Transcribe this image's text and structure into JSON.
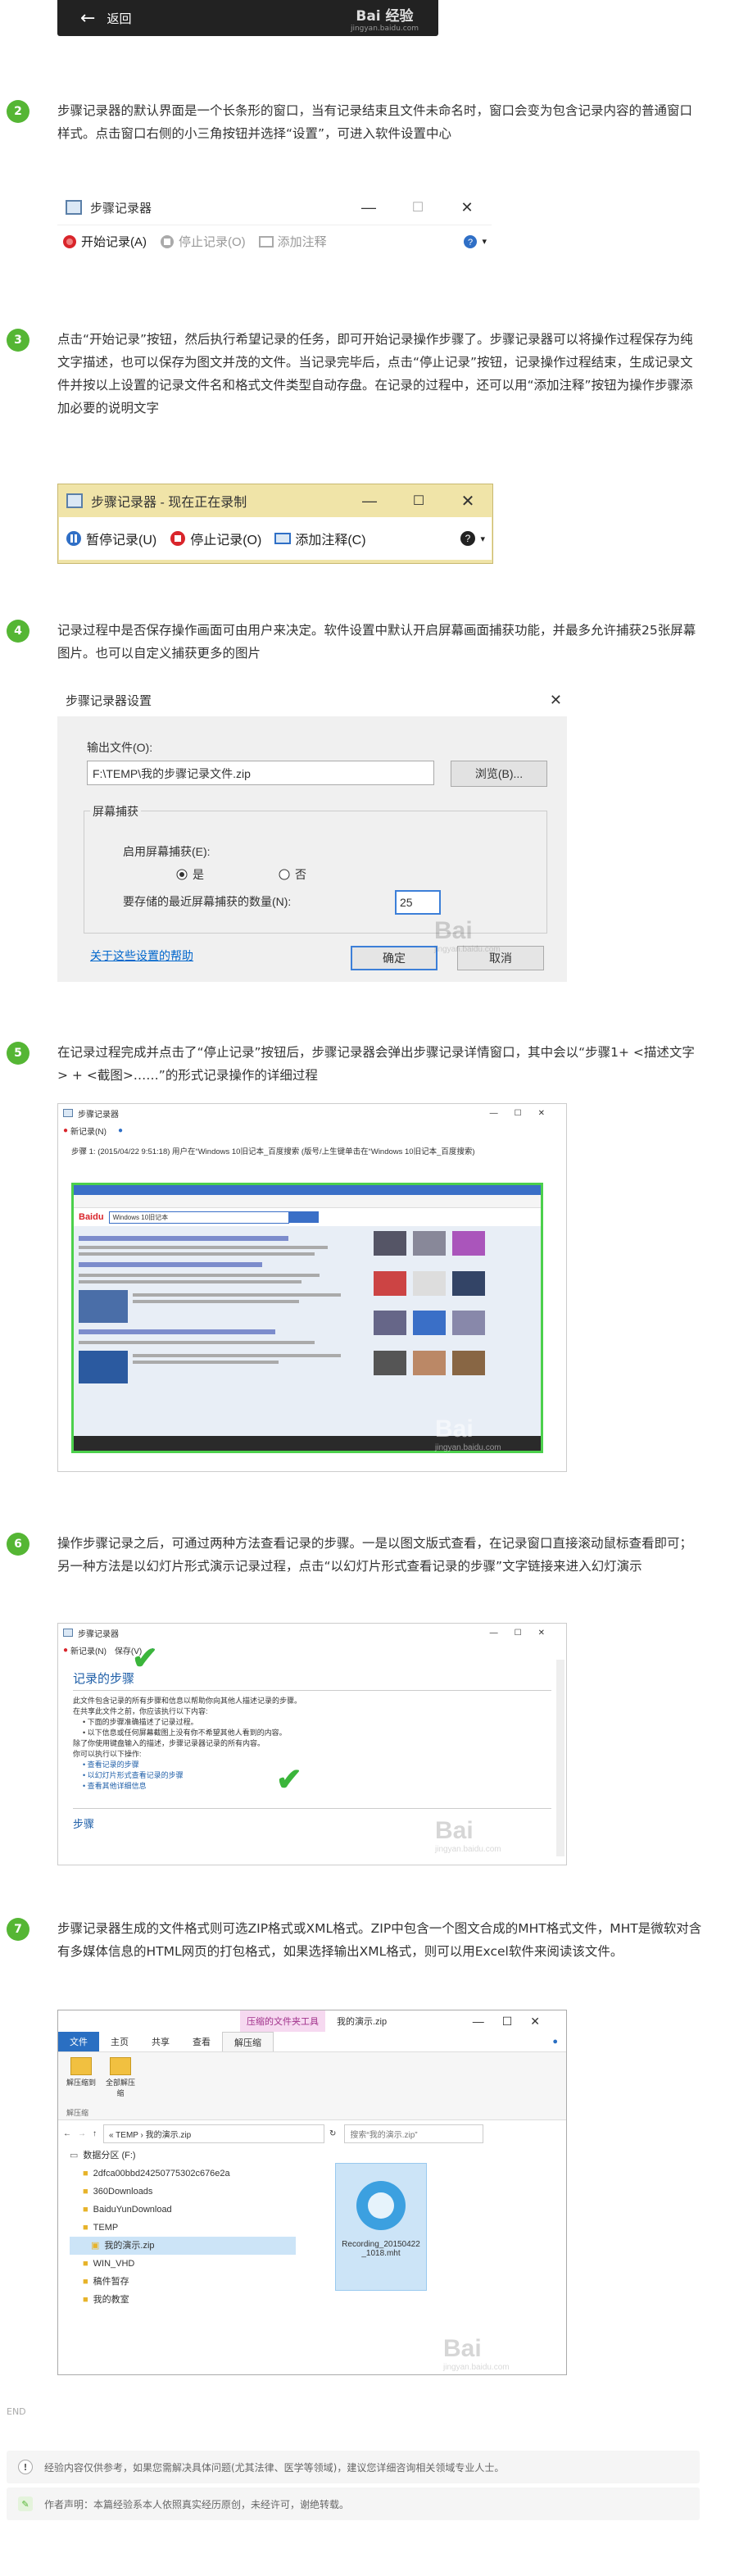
{
  "top_banner": {
    "back_label": "返回",
    "brand": "Bai 经验",
    "site": "jingyan.baidu.com"
  },
  "steps": [
    {
      "num": "2",
      "text": "步骤记录器的默认界面是一个长条形的窗口，当有记录结束且文件未命名时，窗口会变为包含记录内容的普通窗口样式。点击窗口右侧的小三角按钮并选择“设置”，可进入软件设置中心"
    },
    {
      "num": "3",
      "text": "点击“开始记录”按钮，然后执行希望记录的任务，即可开始记录操作步骤了。步骤记录器可以将操作过程保存为纯文字描述，也可以保存为图文并茂的文件。当记录完毕后，点击“停止记录”按钮，记录操作过程结束，生成记录文件并按以上设置的记录文件名和格式文件类型自动存盘。在记录的过程中，还可以用“添加注释”按钮为操作步骤添加必要的说明文字"
    },
    {
      "num": "4",
      "text": "记录过程中是否保存操作画面可由用户来决定。软件设置中默认开启屏幕画面捕获功能，并最多允许捕获25张屏幕图片。也可以自定义捕获更多的图片"
    },
    {
      "num": "5",
      "text": "在记录过程完成并点击了“停止记录”按钮后，步骤记录器会弹出步骤记录详情窗口，其中会以“步骤1+ <描述文字> + <截图>……”的形式记录操作的详细过程"
    },
    {
      "num": "6",
      "text": "操作步骤记录之后，可通过两种方法查看记录的步骤。一是以图文版式查看，在记录窗口直接滚动鼠标查看即可；另一种方法是以幻灯片形式演示记录过程，点击“以幻灯片形式查看记录的步骤”文字链接来进入幻灯演示"
    },
    {
      "num": "7",
      "text": "步骤记录器生成的文件格式则可选ZIP格式或XML格式。ZIP中包含一个图文合成的MHT格式文件，MHT是微软对含有多媒体信息的HTML网页的打包格式，如果选择输出XML格式，则可以用Excel软件来阅读该文件。"
    }
  ],
  "shot1": {
    "title": "步骤记录器",
    "start": "开始记录(A)",
    "stop": "停止记录(O)",
    "note": "添加注释"
  },
  "shot2": {
    "title": "步骤记录器 - 现在正在录制",
    "pause": "暂停记录(U)",
    "stop": "停止记录(O)",
    "note": "添加注释(C)"
  },
  "shot3": {
    "title": "步骤记录器设置",
    "output_label": "输出文件(O):",
    "output_value": "F:\\TEMP\\我的步骤记录文件.zip",
    "browse": "浏览(B)...",
    "group": "屏幕捕获",
    "enable_label": "启用屏幕捕获(E):",
    "yes": "是",
    "no": "否",
    "count_label": "要存储的最近屏幕捕获的数量(N):",
    "count_value": "25",
    "help_link": "关于这些设置的帮助",
    "ok": "确定",
    "cancel": "取消"
  },
  "shot4": {
    "title": "步骤记录器",
    "menu": "新记录(N)",
    "step_line": "步骤 1: (2015/04/22 9:51:18) 用户在“Windows 10旧记本_百度搜索 (版号/上生键单击在“Windows 10旧记本_百度搜索)",
    "search_header": "Windows 10旧记本"
  },
  "shot5": {
    "title": "步骤记录器",
    "menu1": "新记录(N)",
    "menu2": "保存(V)",
    "section": "记录的步骤",
    "lines": [
      "此文件包含记录的所有步骤和信息以帮助你向其他人描述记录的步骤。",
      "在共享此文件之前，你应该执行以下内容:",
      "• 下面的步骤准确描述了记录过程。",
      "• 以下信息或任何屏幕截图上没有你不希望其他人看到的内容。",
      "除了你使用键盘输入的描述，步骤记录器记录的所有内容。",
      "你可以执行以下操作:"
    ],
    "links": [
      "• 查看记录的步骤",
      "• 以幻灯片形式查看记录的步骤",
      "• 查看其他详细信息"
    ],
    "footer": "步骤"
  },
  "shot6": {
    "tool_tab": "压缩的文件夹工具",
    "window_title": "我的演示.zip",
    "tabs": [
      "文件",
      "主页",
      "共享",
      "查看",
      "解压缩"
    ],
    "ribbon_btn1": "解压缩到",
    "ribbon_btn2": "全部解压缩",
    "ribbon_group": "解压缩",
    "path": "« TEMP › 我的演示.zip",
    "search_ph": "搜索“我的演示.zip”",
    "tree": [
      "数据分区 (F:)",
      "2dfca00bbd24250775302c676e2a",
      "360Downloads",
      "BaiduYunDownload",
      "TEMP",
      "我的演示.zip",
      "WIN_VHD",
      "稿件暂存",
      "我的教室"
    ],
    "file_name": "Recording_20150422_1018.mht"
  },
  "end_label": "END",
  "notices": [
    {
      "icon": "!",
      "text": "经验内容仅供参考，如果您需解决具体问题(尤其法律、医学等领域)，建议您详细咨询相关领域专业人士。"
    },
    {
      "icon": "✎",
      "text": "作者声明：本篇经验系本人依照真实经历原创，未经许可，谢绝转载。"
    }
  ],
  "colors": {
    "step_green": "#55b634",
    "link_blue": "#0066cc",
    "bg_grey": "#f5f5f5"
  }
}
